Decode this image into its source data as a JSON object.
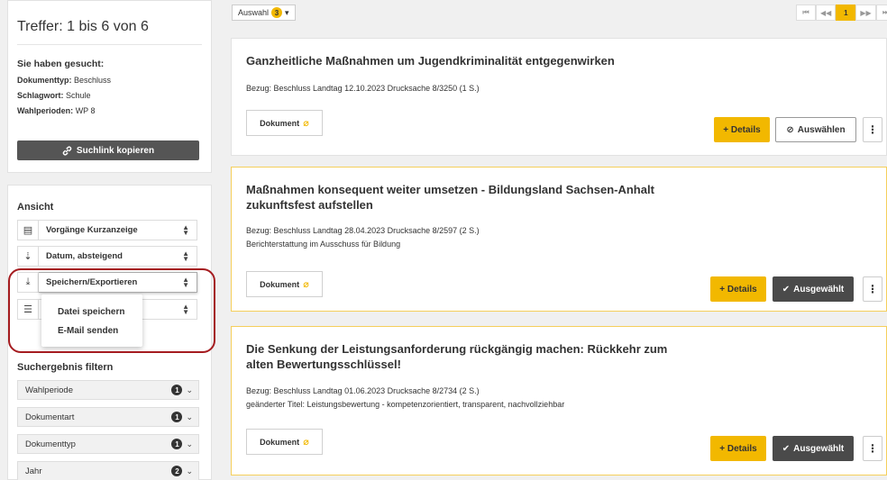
{
  "summary": {
    "hits": "Treffer: 1 bis 6 von 6",
    "searched_heading": "Sie haben gesucht:",
    "criteria": [
      {
        "label": "Dokumenttyp:",
        "value": "Beschluss"
      },
      {
        "label": "Schlagwort:",
        "value": "Schule"
      },
      {
        "label": "Wahlperioden:",
        "value": "WP 8"
      }
    ],
    "copy_link": "Suchlink kopieren"
  },
  "view": {
    "heading": "Ansicht",
    "selects": [
      {
        "icon": "list-icon",
        "label": "Vorgänge Kurzanzeige"
      },
      {
        "icon": "sort-icon",
        "label": "Datum, absteigend"
      },
      {
        "icon": "download-icon",
        "label": "Speichern/Exportieren"
      },
      {
        "icon": "lines-icon",
        "label": ""
      }
    ],
    "dropdown": [
      "Datei speichern",
      "E-Mail senden"
    ]
  },
  "filter": {
    "heading": "Suchergebnis filtern",
    "items": [
      {
        "label": "Wahlperiode",
        "count": "1"
      },
      {
        "label": "Dokumentart",
        "count": "1"
      },
      {
        "label": "Dokumenttyp",
        "count": "1"
      },
      {
        "label": "Jahr",
        "count": "2"
      }
    ]
  },
  "toolbar": {
    "selection_label": "Auswahl",
    "selection_count": "3",
    "pager": [
      "⏮",
      "◀◀",
      "1",
      "▶▶",
      "⏭"
    ],
    "current_page": "1"
  },
  "results": [
    {
      "title": "Ganzheitliche Maßnahmen um Jugendkriminalität entgegenwirken",
      "ref": "Bezug: Beschluss Landtag 12.10.2023 Drucksache 8/3250 (1 S.)",
      "note": "",
      "doc_label": "Dokument",
      "details_label": "+ Details",
      "select_label": "Auswählen",
      "selected": false
    },
    {
      "title": "Maßnahmen konsequent weiter umsetzen - Bildungsland Sachsen-Anhalt zukunftsfest aufstellen",
      "ref": "Bezug: Beschluss Landtag 28.04.2023 Drucksache 8/2597 (2 S.)",
      "note": "Berichterstattung im Ausschuss für Bildung",
      "doc_label": "Dokument",
      "details_label": "+ Details",
      "select_label": "Ausgewählt",
      "selected": true
    },
    {
      "title": "Die Senkung der Leistungsanforderung rückgängig machen: Rückkehr zum alten Bewertungsschlüssel!",
      "ref": "Bezug: Beschluss Landtag 01.06.2023 Drucksache 8/2734 (2 S.)",
      "note": "geänderter Titel: Leistungsbewertung - kompetenzorientiert, transparent, nachvollziehbar",
      "doc_label": "Dokument",
      "details_label": "+ Details",
      "select_label": "Ausgewählt",
      "selected": true
    }
  ],
  "colors": {
    "accent": "#f2b800",
    "dark": "#4a4a4a",
    "highlight_ring": "#a51c20"
  }
}
